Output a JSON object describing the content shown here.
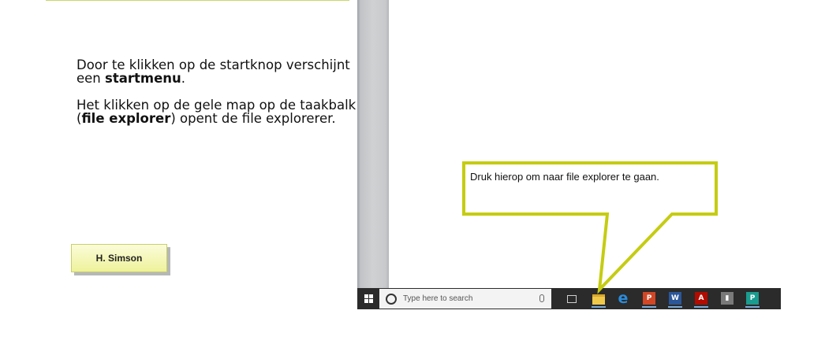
{
  "slide": {
    "paragraph1_before": "Door te klikken op de startknop verschijnt een ",
    "paragraph1_bold": "startmenu",
    "paragraph1_after": ".",
    "paragraph2_before": "Het klikken op de gele map op de taakbalk (",
    "paragraph2_bold": "file explorer",
    "paragraph2_after": ") opent de file explorerer.",
    "author": "H. Simson"
  },
  "callout": {
    "text": "Druk hierop om naar file explorer te gaan."
  },
  "taskbar": {
    "search_placeholder": "Type here to search",
    "icons": {
      "ppt": "P",
      "word": "W",
      "acrobat": "A",
      "util": "▮",
      "pub": "P"
    }
  },
  "colors": {
    "callout_border": "#c5cc12",
    "taskbar": "#2b2b2b",
    "author_box": "#eef29a"
  }
}
